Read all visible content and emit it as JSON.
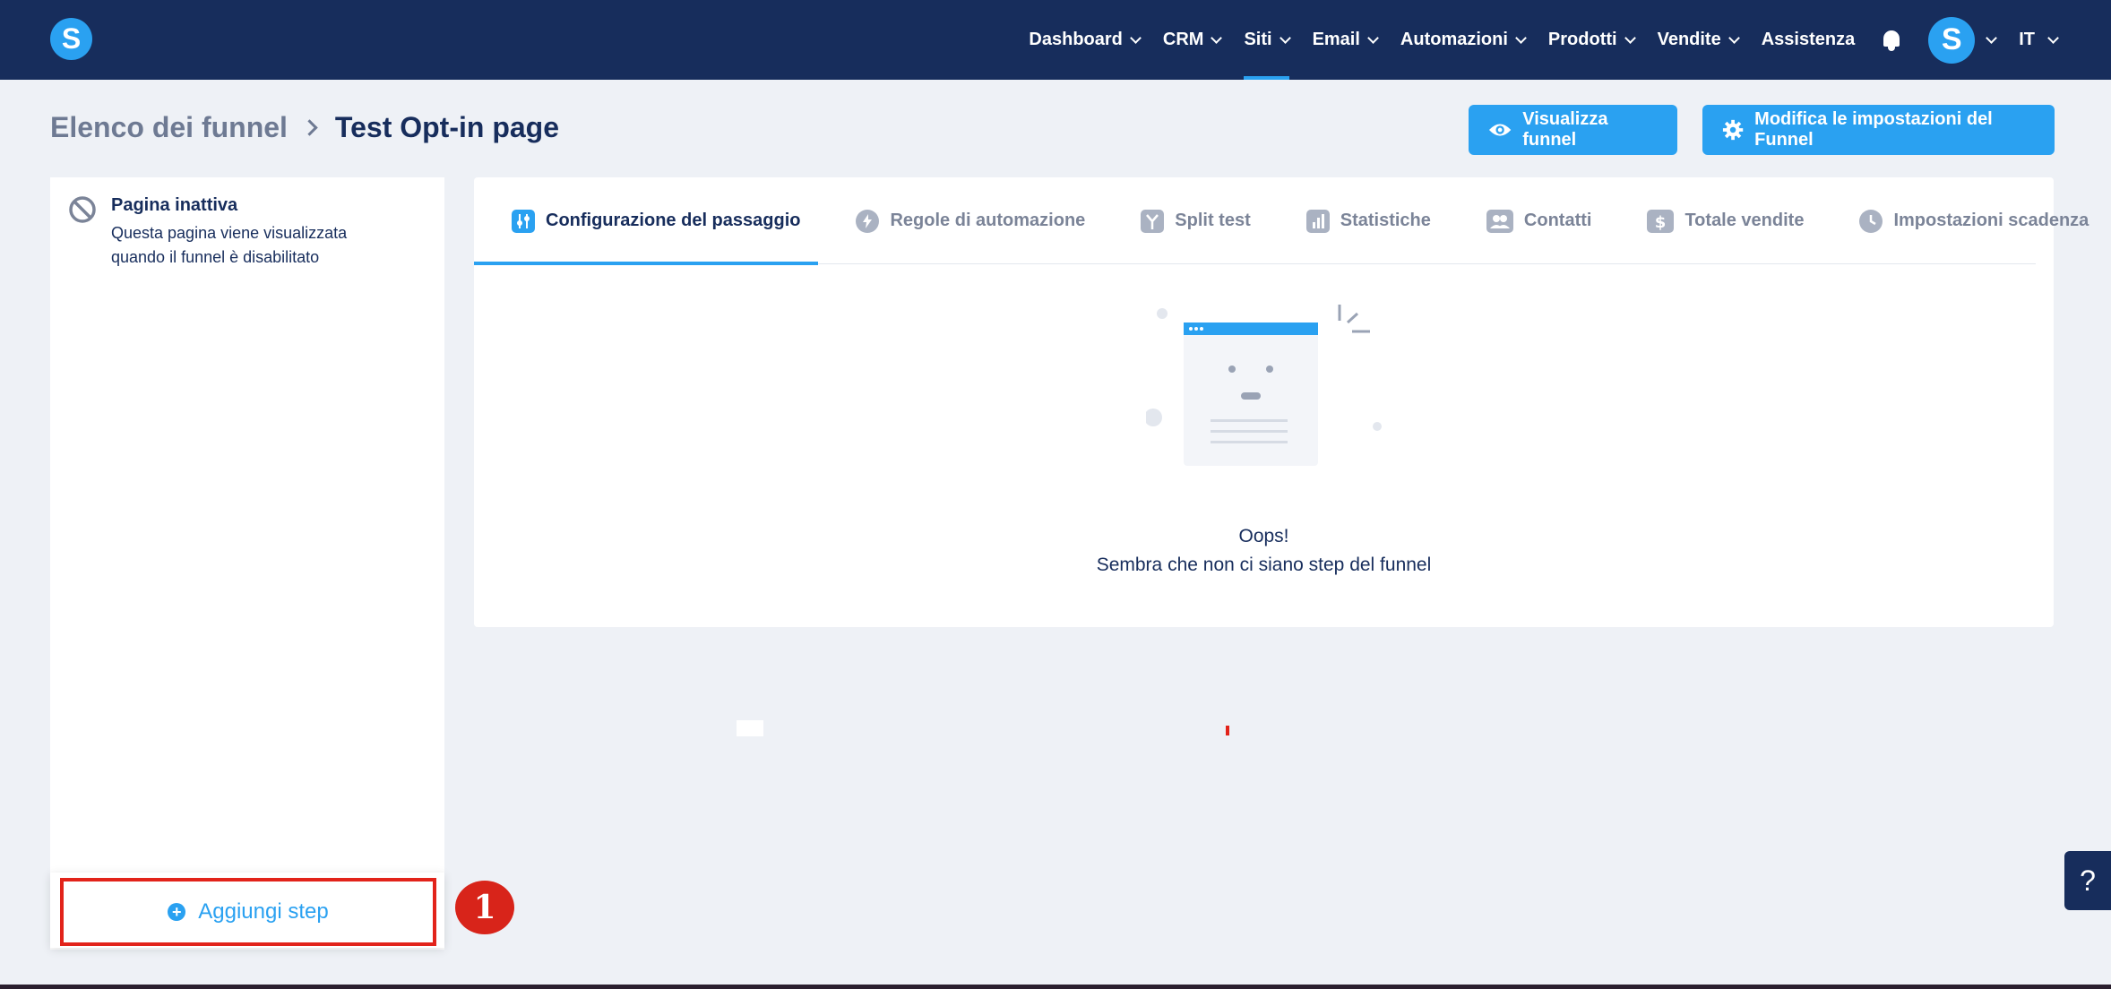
{
  "app": {
    "logo_letter": "S",
    "avatar_letter": "S",
    "language": "IT"
  },
  "nav": {
    "items": [
      {
        "label": "Dashboard",
        "dropdown": true,
        "active": false
      },
      {
        "label": "CRM",
        "dropdown": true,
        "active": false
      },
      {
        "label": "Siti",
        "dropdown": true,
        "active": true
      },
      {
        "label": "Email",
        "dropdown": true,
        "active": false
      },
      {
        "label": "Automazioni",
        "dropdown": true,
        "active": false
      },
      {
        "label": "Prodotti",
        "dropdown": true,
        "active": false
      },
      {
        "label": "Vendite",
        "dropdown": true,
        "active": false
      },
      {
        "label": "Assistenza",
        "dropdown": false,
        "active": false
      }
    ]
  },
  "breadcrumb": {
    "parent": "Elenco dei funnel",
    "current": "Test Opt-in page"
  },
  "actions": {
    "view_funnel": "Visualizza funnel",
    "edit_settings": "Modifica le impostazioni del Funnel"
  },
  "sidebar": {
    "inactive_page": {
      "title": "Pagina inattiva",
      "description": "Questa pagina viene visualizzata quando il funnel è disabilitato"
    },
    "add_step": "Aggiungi step",
    "annotation_marker": "1"
  },
  "tabs": [
    {
      "label": "Configurazione del passaggio",
      "icon": "sliders-icon",
      "active": true
    },
    {
      "label": "Regole di automazione",
      "icon": "bolt-icon",
      "active": false
    },
    {
      "label": "Split test",
      "icon": "split-icon",
      "active": false
    },
    {
      "label": "Statistiche",
      "icon": "chart-icon",
      "active": false
    },
    {
      "label": "Contatti",
      "icon": "contacts-icon",
      "active": false
    },
    {
      "label": "Totale vendite",
      "icon": "dollar-icon",
      "active": false
    },
    {
      "label": "Impostazioni scadenza",
      "icon": "clock-icon",
      "active": false
    }
  ],
  "empty_state": {
    "title": "Oops!",
    "message": "Sembra che non ci siano step del funnel"
  },
  "help_button": "?",
  "colors": {
    "navbar": "#172d5c",
    "accent": "#2aa1f1",
    "highlight": "#e2231a",
    "background": "#eef1f6"
  }
}
